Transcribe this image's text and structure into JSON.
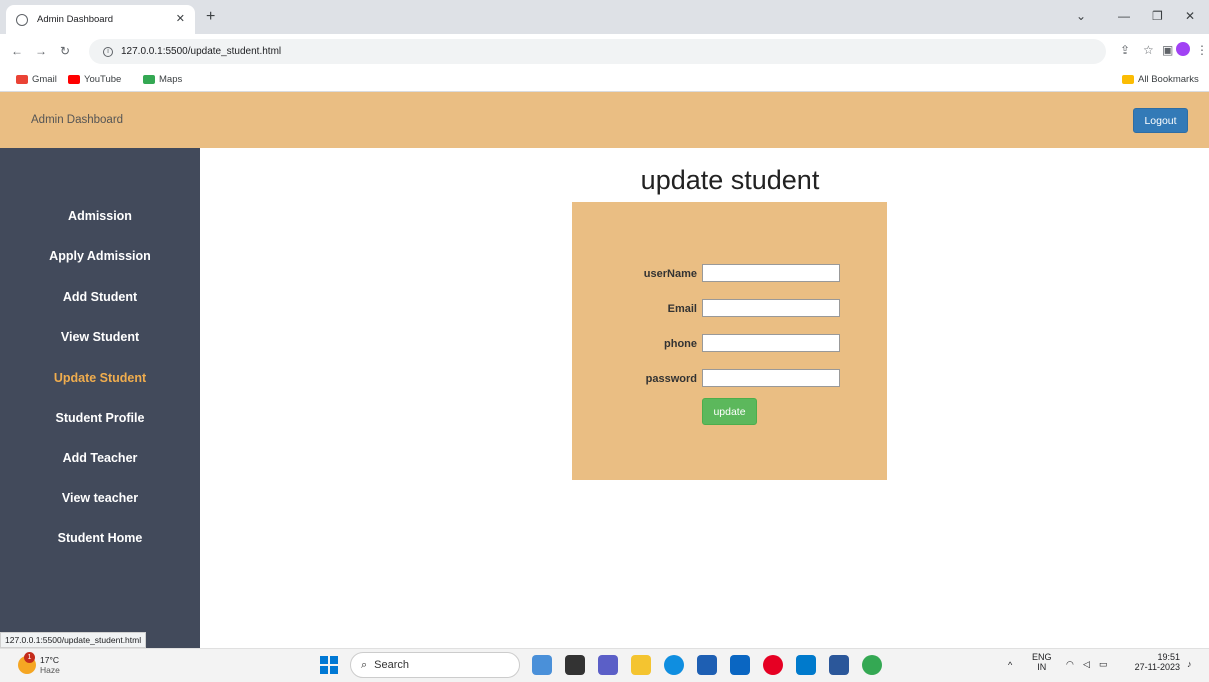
{
  "browser": {
    "tab_title": "Admin Dashboard",
    "url": "127.0.0.1:5500/update_student.html",
    "bookmarks": [
      "Gmail",
      "YouTube",
      "Maps"
    ],
    "all_bookmarks": "All Bookmarks",
    "status_url": "127.0.0.1:5500/update_student.html"
  },
  "header": {
    "brand": "Admin Dashboard",
    "logout_label": "Logout"
  },
  "sidebar": {
    "items": [
      {
        "label": "Admission",
        "active": false
      },
      {
        "label": "Apply Admission",
        "active": false
      },
      {
        "label": "Add Student",
        "active": false
      },
      {
        "label": "View Student",
        "active": false
      },
      {
        "label": "Update Student",
        "active": true
      },
      {
        "label": "Student Profile",
        "active": false
      },
      {
        "label": "Add Teacher",
        "active": false
      },
      {
        "label": "View teacher",
        "active": false
      },
      {
        "label": "Student Home",
        "active": false
      }
    ]
  },
  "main": {
    "title": "update student",
    "fields": [
      {
        "label": "userName",
        "value": ""
      },
      {
        "label": "Email",
        "value": ""
      },
      {
        "label": "phone",
        "value": ""
      },
      {
        "label": "password",
        "value": ""
      }
    ],
    "submit_label": "update"
  },
  "taskbar": {
    "temperature": "17°C",
    "condition": "Haze",
    "weather_badge": "1",
    "search_placeholder": "Search",
    "lang_top": "ENG",
    "lang_bottom": "IN",
    "time": "19:51",
    "date": "27-11-2023"
  },
  "colors": {
    "header_bg": "#eabe83",
    "sidebar_bg": "#424a5b",
    "active_nav": "#f0ad4e",
    "logout_btn": "#337ab7",
    "update_btn": "#5cb85c"
  }
}
